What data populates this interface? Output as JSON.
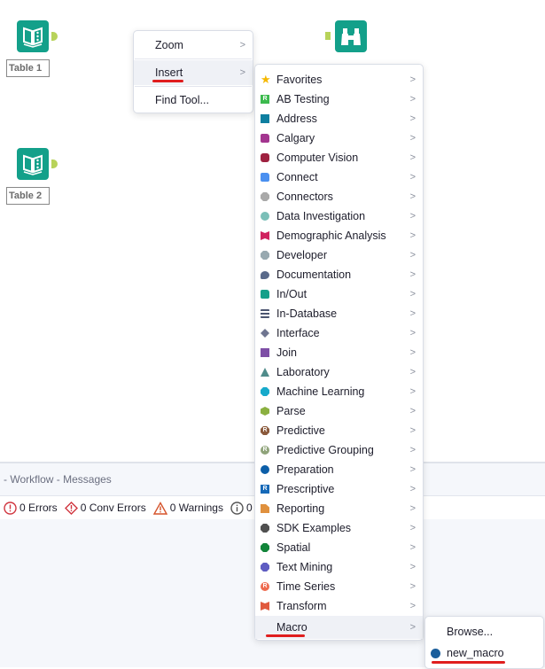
{
  "canvas": {
    "tools": [
      {
        "label": "Table 1"
      },
      {
        "label": "Table 2"
      }
    ],
    "browse_tool": {
      "icon": "binoculars-icon"
    }
  },
  "context_menu": {
    "items": [
      {
        "label": "Zoom",
        "has_submenu": true
      },
      {
        "label": "Insert",
        "has_submenu": true,
        "active": true
      },
      {
        "label": "Find Tool...",
        "has_submenu": false
      }
    ]
  },
  "insert_menu": {
    "items": [
      {
        "label": "Favorites",
        "icon": "star",
        "color": "#f5b800"
      },
      {
        "label": "AB Testing",
        "icon": "r-square",
        "color": "#3cba4e"
      },
      {
        "label": "Address",
        "icon": "square",
        "color": "#0e7fa0"
      },
      {
        "label": "Calgary",
        "icon": "folder",
        "color": "#a3358f"
      },
      {
        "label": "Computer Vision",
        "icon": "rounded",
        "color": "#9e2140"
      },
      {
        "label": "Connect",
        "icon": "folder",
        "color": "#4a90f0"
      },
      {
        "label": "Connectors",
        "icon": "octagon",
        "color": "#a9a9a9"
      },
      {
        "label": "Data Investigation",
        "icon": "circle",
        "color": "#7bbfb8"
      },
      {
        "label": "Demographic Analysis",
        "icon": "bow",
        "color": "#d0235f"
      },
      {
        "label": "Developer",
        "icon": "octagon",
        "color": "#98a9b0"
      },
      {
        "label": "Documentation",
        "icon": "bubble",
        "color": "#5a6a8a"
      },
      {
        "label": "In/Out",
        "icon": "folder",
        "color": "#14a08a"
      },
      {
        "label": "In-Database",
        "icon": "stack",
        "color": "#4b5570"
      },
      {
        "label": "Interface",
        "icon": "diamond",
        "color": "#6f7590"
      },
      {
        "label": "Join",
        "icon": "square",
        "color": "#7e4fa6"
      },
      {
        "label": "Laboratory",
        "icon": "triangle",
        "color": "#4f8c8a"
      },
      {
        "label": "Machine Learning",
        "icon": "octagon",
        "color": "#17aacb"
      },
      {
        "label": "Parse",
        "icon": "hexagon",
        "color": "#8bb040"
      },
      {
        "label": "Predictive",
        "icon": "r-octagon",
        "color": "#8b5a3c"
      },
      {
        "label": "Predictive Grouping",
        "icon": "r-circle",
        "color": "#8fa37a"
      },
      {
        "label": "Preparation",
        "icon": "circle",
        "color": "#0c5ea8"
      },
      {
        "label": "Prescriptive",
        "icon": "r-square",
        "color": "#1669b8"
      },
      {
        "label": "Reporting",
        "icon": "doc",
        "color": "#e0913e"
      },
      {
        "label": "SDK Examples",
        "icon": "octagon",
        "color": "#505050"
      },
      {
        "label": "Spatial",
        "icon": "octagon",
        "color": "#12853a"
      },
      {
        "label": "Text Mining",
        "icon": "octagon",
        "color": "#5e5cc2"
      },
      {
        "label": "Time Series",
        "icon": "r-circle",
        "color": "#ee6a4e"
      },
      {
        "label": "Transform",
        "icon": "bow",
        "color": "#e05a3e"
      },
      {
        "label": "Macro",
        "icon": "none",
        "color": "",
        "active": true
      }
    ]
  },
  "macro_menu": {
    "items": [
      {
        "label": "Browse..."
      },
      {
        "label": "new_macro",
        "color": "#1b5e9b"
      }
    ]
  },
  "panel": {
    "title": "- Workflow - Messages",
    "errors": "0 Errors",
    "conv_errors": "0 Conv Errors",
    "warnings": "0 Warnings",
    "info": "0"
  }
}
